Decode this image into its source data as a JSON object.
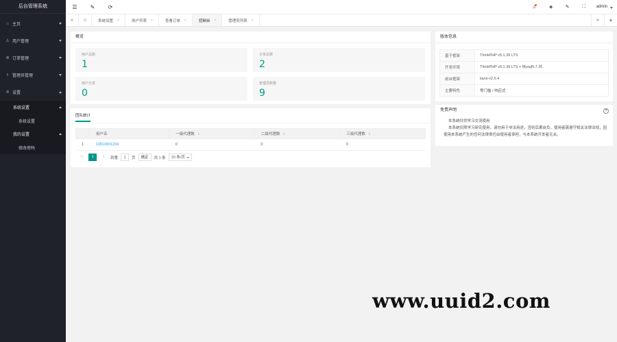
{
  "app": {
    "title": "后台管理系统"
  },
  "sidebar": {
    "items": [
      {
        "label": "主页",
        "icon": "home-icon",
        "glyph": "⌂"
      },
      {
        "label": "用户管理",
        "icon": "user-icon",
        "glyph": "♙"
      },
      {
        "label": "订单管理",
        "icon": "order-icon",
        "glyph": "≣"
      },
      {
        "label": "管理员管理",
        "icon": "admin-icon",
        "glyph": "♗"
      },
      {
        "label": "设置",
        "icon": "settings-icon",
        "glyph": "✲"
      }
    ],
    "submenu": [
      {
        "head": "系统设置",
        "leaf": "系统设置"
      },
      {
        "head": "我的设置",
        "leaf": "修改密码"
      }
    ]
  },
  "header": {
    "icons": {
      "menu": "☰",
      "refresh": "⟳",
      "skin": "✎",
      "bell": "♫",
      "theme": "◈",
      "fullscreen": "⛶"
    },
    "user": "admin"
  },
  "tabs": {
    "home_glyph": "⌂",
    "prev_glyph": "«",
    "next_glyph": "»",
    "more_glyph": "▾",
    "items": [
      {
        "label": "系统设置"
      },
      {
        "label": "用户列表"
      },
      {
        "label": "查看订单"
      },
      {
        "label": "控制台",
        "active": true
      },
      {
        "label": "管理员列表"
      }
    ],
    "close_glyph": "×"
  },
  "overview": {
    "title": "概览",
    "stats": [
      {
        "label": "用户总数",
        "value": "1"
      },
      {
        "label": "订单总数",
        "value": "2"
      },
      {
        "label": "用户分享",
        "value": "0"
      },
      {
        "label": "管理员数量",
        "value": "9"
      }
    ]
  },
  "team": {
    "tab": "团队统计",
    "columns": [
      "",
      "用户名",
      "一级代理数",
      "二级代理数",
      "三级代理数"
    ],
    "sort_glyph": "⇕",
    "rows": [
      {
        "idx": "1",
        "user": "13810901234",
        "l1": "0",
        "l2": "0",
        "l3": "0"
      }
    ],
    "pager": {
      "prev": "‹",
      "current": "1",
      "next": "›",
      "goto": "到第",
      "page_input": "1",
      "page_unit": "页",
      "confirm": "确定",
      "total": "共 1 条",
      "per_page": "10 条/页"
    }
  },
  "version": {
    "title": "版本信息",
    "rows": [
      {
        "k": "基于框架",
        "v": "ThinkPHP v5.1.39 LTS"
      },
      {
        "k": "开发环境",
        "v": "ThinkPHP v5.1.39 LTS + Mysql5.7.26"
      },
      {
        "k": "前台框架",
        "v": "layui-v2.5.4"
      },
      {
        "k": "主要特色",
        "v": "零门槛 / 响应式"
      }
    ]
  },
  "notice": {
    "title": "免责声明",
    "help_glyph": "?",
    "lines": [
      "本系统仅供学习交流使用",
      "本系统仅限学习研究使用，请勿用于非法用途，否则后果自负。使用者需遵守相关法律法规，因使用本系统产生的任何法律责任由使用者承担，与本系统开发者无关。"
    ]
  },
  "watermark": "www.uuid2.com"
}
